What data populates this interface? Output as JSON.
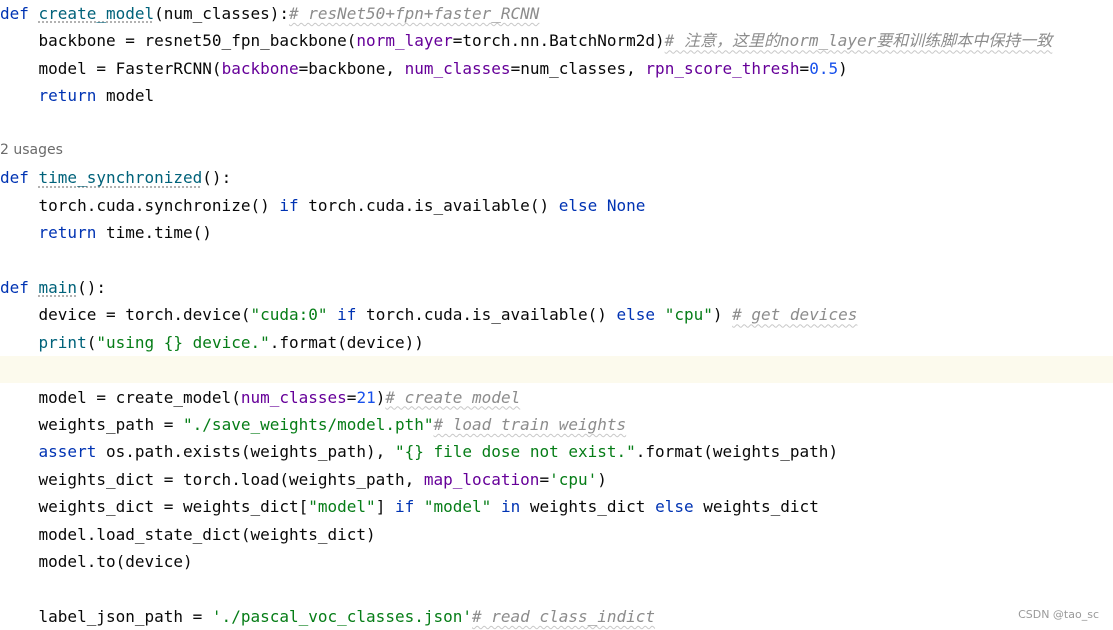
{
  "code": {
    "lines": [
      {
        "tokens": [
          [
            "kw",
            "def "
          ],
          [
            "def",
            "create_model"
          ],
          [
            "",
            "(num_classes):"
          ],
          [
            "cmt warn",
            "# resNet50+fpn+faster_RCNN"
          ]
        ]
      },
      {
        "tokens": [
          [
            "",
            "    backbone = resnet50_fpn_backbone("
          ],
          [
            "param",
            "norm_layer"
          ],
          [
            "",
            "=torch.nn.BatchNorm2d)"
          ],
          [
            "cmt warn",
            "# 注意，这里的norm_layer要和训练脚本中保持一致"
          ]
        ]
      },
      {
        "tokens": [
          [
            "",
            "    model = FasterRCNN("
          ],
          [
            "param",
            "backbone"
          ],
          [
            "",
            "=backbone, "
          ],
          [
            "param",
            "num_classes"
          ],
          [
            "",
            "=num_classes, "
          ],
          [
            "param",
            "rpn_score_thresh"
          ],
          [
            "",
            "="
          ],
          [
            "num",
            "0.5"
          ],
          [
            "",
            ")"
          ]
        ]
      },
      {
        "tokens": [
          [
            "",
            "    "
          ],
          [
            "kw",
            "return"
          ],
          [
            "",
            " model"
          ]
        ]
      },
      {
        "tokens": []
      },
      {
        "type": "hint",
        "tokens": [
          [
            "",
            "2 usages"
          ]
        ]
      },
      {
        "tokens": [
          [
            "kw",
            "def "
          ],
          [
            "def",
            "time_synchronized"
          ],
          [
            "",
            "():"
          ]
        ]
      },
      {
        "tokens": [
          [
            "",
            "    torch.cuda.synchronize() "
          ],
          [
            "kw",
            "if"
          ],
          [
            "",
            " torch.cuda.is_available() "
          ],
          [
            "kw",
            "else"
          ],
          [
            "",
            " "
          ],
          [
            "kw",
            "None"
          ]
        ]
      },
      {
        "tokens": [
          [
            "",
            "    "
          ],
          [
            "kw",
            "return"
          ],
          [
            "",
            " time.time()"
          ]
        ]
      },
      {
        "tokens": []
      },
      {
        "tokens": [
          [
            "kw",
            "def "
          ],
          [
            "def",
            "main"
          ],
          [
            "",
            "():"
          ]
        ]
      },
      {
        "tokens": [
          [
            "",
            "    device = torch.device("
          ],
          [
            "str",
            "\"cuda:0\""
          ],
          [
            "",
            " "
          ],
          [
            "kw",
            "if"
          ],
          [
            "",
            " torch.cuda.is_available() "
          ],
          [
            "kw",
            "else"
          ],
          [
            "",
            " "
          ],
          [
            "str",
            "\"cpu\""
          ],
          [
            "",
            ") "
          ],
          [
            "cmt warn",
            "# get devices"
          ]
        ]
      },
      {
        "tokens": [
          [
            "",
            "    "
          ],
          [
            "fn",
            "print"
          ],
          [
            "",
            "("
          ],
          [
            "str",
            "\"using {} device.\""
          ],
          [
            "",
            ".format(device))"
          ]
        ]
      },
      {
        "type": "current",
        "tokens": []
      },
      {
        "tokens": [
          [
            "",
            "    model = create_model("
          ],
          [
            "param",
            "num_classes"
          ],
          [
            "",
            "="
          ],
          [
            "num",
            "21"
          ],
          [
            "",
            ")"
          ],
          [
            "cmt warn",
            "# create model"
          ]
        ]
      },
      {
        "tokens": [
          [
            "",
            "    weights_path = "
          ],
          [
            "str",
            "\"./save_weights/model.pth\""
          ],
          [
            "cmt warn",
            "# load train weights"
          ]
        ]
      },
      {
        "tokens": [
          [
            "",
            "    "
          ],
          [
            "kw",
            "assert"
          ],
          [
            "",
            " os.path.exists(weights_path), "
          ],
          [
            "str",
            "\"{} file dose not exist.\""
          ],
          [
            "",
            ".format(weights_path)"
          ]
        ]
      },
      {
        "tokens": [
          [
            "",
            "    weights_dict = torch.load(weights_path, "
          ],
          [
            "param",
            "map_location"
          ],
          [
            "",
            "="
          ],
          [
            "str",
            "'cpu'"
          ],
          [
            "",
            ")"
          ]
        ]
      },
      {
        "tokens": [
          [
            "",
            "    weights_dict = weights_dict["
          ],
          [
            "str",
            "\"model\""
          ],
          [
            "",
            "] "
          ],
          [
            "kw",
            "if"
          ],
          [
            "",
            " "
          ],
          [
            "str",
            "\"model\""
          ],
          [
            "",
            " "
          ],
          [
            "kw",
            "in"
          ],
          [
            "",
            " weights_dict "
          ],
          [
            "kw",
            "else"
          ],
          [
            "",
            " weights_dict"
          ]
        ]
      },
      {
        "tokens": [
          [
            "",
            "    model.load_state_dict(weights_dict)"
          ]
        ]
      },
      {
        "tokens": [
          [
            "",
            "    model.to(device)"
          ]
        ]
      },
      {
        "tokens": []
      },
      {
        "tokens": [
          [
            "",
            "    label_json_path = "
          ],
          [
            "str",
            "'./pascal_voc_classes.json'"
          ],
          [
            "cmt warn",
            "# read class_indict"
          ]
        ]
      }
    ]
  },
  "watermark": "CSDN @tao_sc"
}
